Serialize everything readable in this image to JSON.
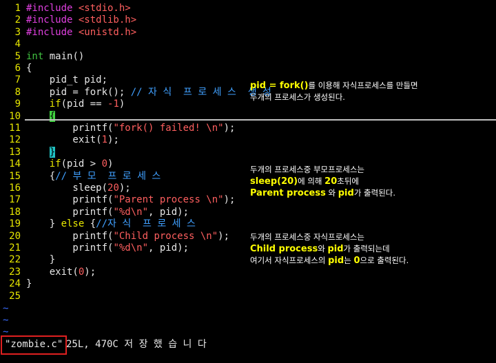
{
  "file": {
    "status_name": "\"zombie.c\"",
    "status_info": "25L, 470C 저 장  했 습 니 다"
  },
  "lines": [
    {
      "n": "1",
      "parts": [
        {
          "c": "pp",
          "t": "#include "
        },
        {
          "c": "str",
          "t": "<stdio.h>"
        }
      ]
    },
    {
      "n": "2",
      "parts": [
        {
          "c": "pp",
          "t": "#include "
        },
        {
          "c": "str",
          "t": "<stdlib.h>"
        }
      ]
    },
    {
      "n": "3",
      "parts": [
        {
          "c": "pp",
          "t": "#include "
        },
        {
          "c": "str",
          "t": "<unistd.h>"
        }
      ]
    },
    {
      "n": "4",
      "parts": []
    },
    {
      "n": "5",
      "parts": [
        {
          "c": "type",
          "t": "int"
        },
        {
          "c": "",
          "t": " main()"
        }
      ]
    },
    {
      "n": "6",
      "parts": [
        {
          "c": "",
          "t": "{"
        }
      ]
    },
    {
      "n": "7",
      "parts": [
        {
          "c": "",
          "t": "    pid_t pid;"
        }
      ]
    },
    {
      "n": "8",
      "parts": [
        {
          "c": "",
          "t": "    pid = fork(); "
        },
        {
          "c": "cmt",
          "t": "// 자 식  프 로 세 스  생 성"
        }
      ]
    },
    {
      "n": "9",
      "parts": [
        {
          "c": "",
          "t": "    "
        },
        {
          "c": "kw",
          "t": "if"
        },
        {
          "c": "",
          "t": "(pid == "
        },
        {
          "c": "num",
          "t": "-1"
        },
        {
          "c": "",
          "t": ")"
        }
      ]
    },
    {
      "n": "10",
      "parts": [
        {
          "c": "",
          "t": "    "
        },
        {
          "c": "brace-hl2",
          "t": "{"
        }
      ]
    },
    {
      "n": "11",
      "parts": [
        {
          "c": "",
          "t": "        printf("
        },
        {
          "c": "str",
          "t": "\"fork() failed! \\n\""
        },
        {
          "c": "",
          "t": ");"
        }
      ]
    },
    {
      "n": "12",
      "parts": [
        {
          "c": "",
          "t": "        exit("
        },
        {
          "c": "num",
          "t": "1"
        },
        {
          "c": "",
          "t": ");"
        }
      ]
    },
    {
      "n": "13",
      "parts": [
        {
          "c": "",
          "t": "    "
        },
        {
          "c": "brace-hl",
          "t": "}"
        }
      ]
    },
    {
      "n": "14",
      "parts": [
        {
          "c": "",
          "t": "    "
        },
        {
          "c": "kw",
          "t": "if"
        },
        {
          "c": "",
          "t": "(pid > "
        },
        {
          "c": "num",
          "t": "0"
        },
        {
          "c": "",
          "t": ")"
        }
      ]
    },
    {
      "n": "15",
      "parts": [
        {
          "c": "",
          "t": "    {"
        },
        {
          "c": "cmt",
          "t": "// 부 모  프 로 세 스"
        }
      ]
    },
    {
      "n": "16",
      "parts": [
        {
          "c": "",
          "t": "        sleep("
        },
        {
          "c": "num",
          "t": "20"
        },
        {
          "c": "",
          "t": ");"
        }
      ]
    },
    {
      "n": "17",
      "parts": [
        {
          "c": "",
          "t": "        printf("
        },
        {
          "c": "str",
          "t": "\"Parent process \\n\""
        },
        {
          "c": "",
          "t": ");"
        }
      ]
    },
    {
      "n": "18",
      "parts": [
        {
          "c": "",
          "t": "        printf("
        },
        {
          "c": "str",
          "t": "\"%d\\n\""
        },
        {
          "c": "",
          "t": ", pid);"
        }
      ]
    },
    {
      "n": "19",
      "parts": [
        {
          "c": "",
          "t": "    } "
        },
        {
          "c": "kw",
          "t": "else"
        },
        {
          "c": "",
          "t": " {"
        },
        {
          "c": "cmt",
          "t": "//자 식  프 로 세 스"
        }
      ]
    },
    {
      "n": "20",
      "parts": [
        {
          "c": "",
          "t": "        printf("
        },
        {
          "c": "str",
          "t": "\"Child process \\n\""
        },
        {
          "c": "",
          "t": ");"
        }
      ]
    },
    {
      "n": "21",
      "parts": [
        {
          "c": "",
          "t": "        printf("
        },
        {
          "c": "str",
          "t": "\"%d\\n\""
        },
        {
          "c": "",
          "t": ", pid);"
        }
      ]
    },
    {
      "n": "22",
      "parts": [
        {
          "c": "",
          "t": "    }"
        }
      ]
    },
    {
      "n": "23",
      "parts": [
        {
          "c": "",
          "t": "    exit("
        },
        {
          "c": "num",
          "t": "0"
        },
        {
          "c": "",
          "t": ");"
        }
      ]
    },
    {
      "n": "24",
      "parts": [
        {
          "c": "",
          "t": "}"
        }
      ]
    },
    {
      "n": "25",
      "parts": []
    }
  ],
  "tildes": [
    "~",
    "~",
    "~"
  ],
  "annotations": [
    {
      "lines": [
        [
          {
            "b": true,
            "t": "pid = fork()"
          },
          {
            "b": false,
            "t": "를 이용해 자식프로세스를 만들면"
          }
        ],
        [
          {
            "b": false,
            "t": "두개의 프로세스가 생성된다."
          }
        ]
      ]
    },
    {
      "lines": [
        [
          {
            "b": false,
            "t": "두개의 프로세스중 부모프로세스는"
          }
        ],
        [
          {
            "b": true,
            "t": "sleep(20)"
          },
          {
            "b": false,
            "t": "에 의해 "
          },
          {
            "b": true,
            "t": "20"
          },
          {
            "b": false,
            "t": "초뒤에"
          }
        ],
        [
          {
            "b": true,
            "t": "Parent process"
          },
          {
            "b": false,
            "t": " 와 "
          },
          {
            "b": true,
            "t": "pid"
          },
          {
            "b": false,
            "t": "가 출력된다."
          }
        ]
      ]
    },
    {
      "lines": [
        [
          {
            "b": false,
            "t": "두개의 프로세스중 자식프로세스는"
          }
        ],
        [
          {
            "b": true,
            "t": "Child process"
          },
          {
            "b": false,
            "t": "와 "
          },
          {
            "b": true,
            "t": "pid"
          },
          {
            "b": false,
            "t": "가 출력되는데"
          }
        ],
        [
          {
            "b": false,
            "t": "여기서 자식프로세스의 "
          },
          {
            "b": true,
            "t": "pid"
          },
          {
            "b": false,
            "t": "는 "
          },
          {
            "b": true,
            "t": "0"
          },
          {
            "b": false,
            "t": "으로 출력된다."
          }
        ]
      ]
    }
  ]
}
